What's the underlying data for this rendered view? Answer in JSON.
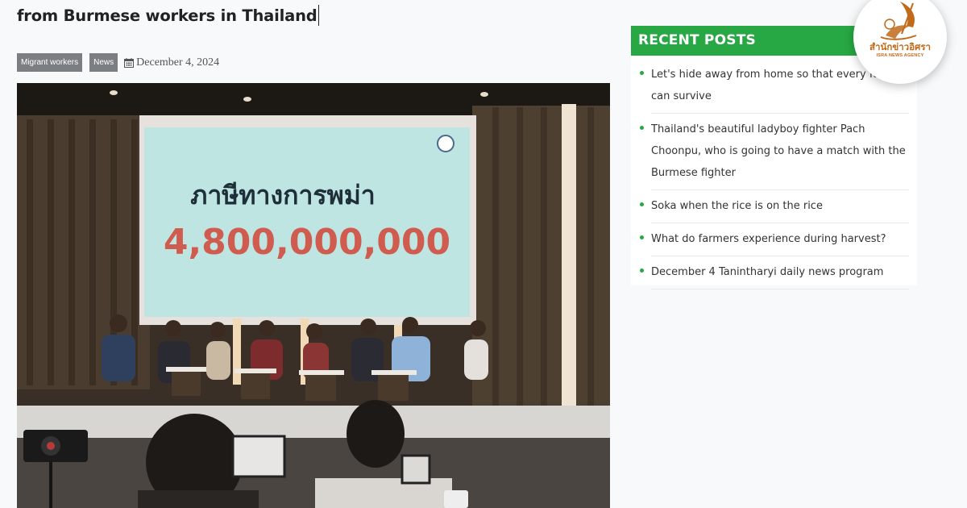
{
  "article": {
    "title_line2": "from Burmese workers in Thailand",
    "tags": [
      "Migrant workers",
      "News"
    ],
    "date": "December 4, 2024",
    "photo": {
      "screen_text_th": "ภาษีทางการพม่า",
      "screen_number": "4,800,000,000"
    }
  },
  "sidebar": {
    "heading": "RECENT POSTS",
    "posts": [
      "Let's hide away from home so that every family can survive",
      "Thailand's beautiful ladyboy fighter Pach Choonpu, who is going to have a match with the Burmese fighter",
      "Soka when the rice is on the rice",
      "What do farmers experience during harvest?",
      "December 4 Tanintharyi daily news program"
    ]
  },
  "logo": {
    "thai_text": "สำนักข่าวอิศรา",
    "english_text": "ISRA NEWS AGENCY"
  },
  "colors": {
    "accent_green": "#27a844",
    "tag_gray": "#7b7f82",
    "logo_gold": "#c06a1a"
  },
  "icons": {
    "date": "calendar-icon",
    "bullet": "bullet-dot-icon"
  }
}
